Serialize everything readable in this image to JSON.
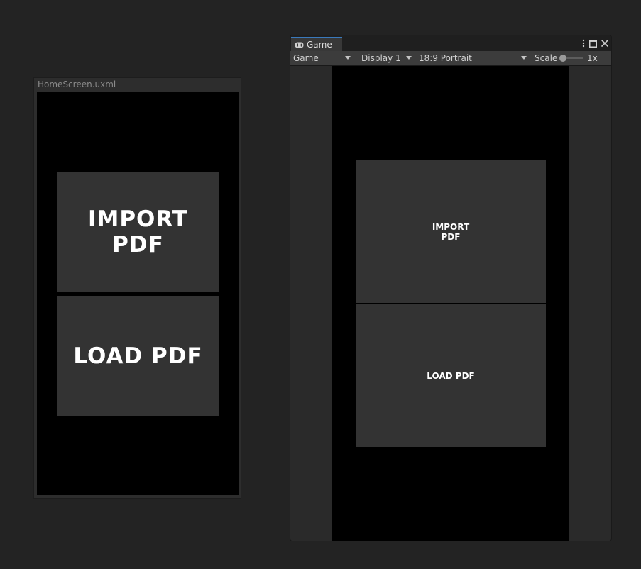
{
  "uxml_preview": {
    "title": "HomeScreen.uxml",
    "import_label": "IMPORT\nPDF",
    "load_label": "LOAD PDF"
  },
  "game_window": {
    "tab": {
      "label": "Game",
      "icon": "gamepad-icon"
    },
    "controls": {
      "menu_icon": "kebab-menu-icon",
      "maximize_icon": "maximize-icon",
      "close_icon": "close-icon"
    },
    "toolbar": {
      "mode": "Game",
      "display": "Display 1",
      "aspect": "18:9 Portrait",
      "scale_label": "Scale",
      "scale_value": "1x"
    },
    "buttons": {
      "import_label": "IMPORT\nPDF",
      "load_label": "LOAD PDF"
    }
  },
  "colors": {
    "background": "#232323",
    "panel": "#2d2d2d",
    "canvas": "#000000",
    "button": "#333333",
    "tab_accent": "#3a79bb",
    "text": "#ffffff"
  }
}
